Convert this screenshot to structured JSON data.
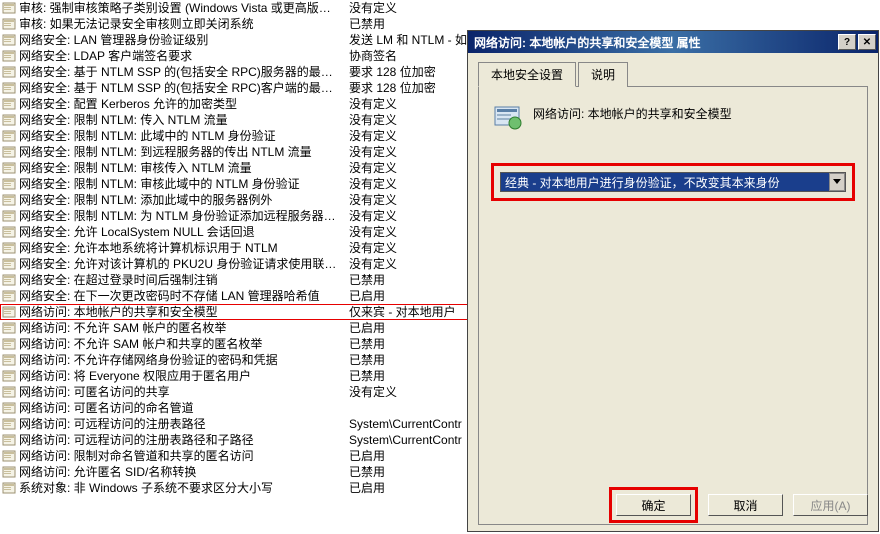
{
  "policies": [
    {
      "name": "审核: 强制审核策略子类别设置 (Windows Vista 或更高版…",
      "value": "没有定义"
    },
    {
      "name": "审核: 如果无法记录安全审核则立即关闭系统",
      "value": "已禁用"
    },
    {
      "name": "网络安全: LAN 管理器身份验证级别",
      "value": "发送 LM 和 NTLM - 如"
    },
    {
      "name": "网络安全: LDAP 客户端签名要求",
      "value": "协商签名"
    },
    {
      "name": "网络安全: 基于 NTLM SSP 的(包括安全 RPC)服务器的最…",
      "value": "要求 128 位加密"
    },
    {
      "name": "网络安全: 基于 NTLM SSP 的(包括安全 RPC)客户端的最…",
      "value": "要求 128 位加密"
    },
    {
      "name": "网络安全: 配置 Kerberos 允许的加密类型",
      "value": "没有定义"
    },
    {
      "name": "网络安全: 限制 NTLM: 传入 NTLM 流量",
      "value": "没有定义"
    },
    {
      "name": "网络安全: 限制 NTLM: 此域中的 NTLM 身份验证",
      "value": "没有定义"
    },
    {
      "name": "网络安全: 限制 NTLM: 到远程服务器的传出 NTLM 流量",
      "value": "没有定义"
    },
    {
      "name": "网络安全: 限制 NTLM: 审核传入 NTLM 流量",
      "value": "没有定义"
    },
    {
      "name": "网络安全: 限制 NTLM: 审核此域中的 NTLM 身份验证",
      "value": "没有定义"
    },
    {
      "name": "网络安全: 限制 NTLM: 添加此域中的服务器例外",
      "value": "没有定义"
    },
    {
      "name": "网络安全: 限制 NTLM: 为 NTLM 身份验证添加远程服务器…",
      "value": "没有定义"
    },
    {
      "name": "网络安全: 允许 LocalSystem NULL 会话回退",
      "value": "没有定义"
    },
    {
      "name": "网络安全: 允许本地系统将计算机标识用于 NTLM",
      "value": "没有定义"
    },
    {
      "name": "网络安全: 允许对该计算机的 PKU2U 身份验证请求使用联…",
      "value": "没有定义"
    },
    {
      "name": "网络安全: 在超过登录时间后强制注销",
      "value": "已禁用"
    },
    {
      "name": "网络安全: 在下一次更改密码时不存储 LAN 管理器哈希值",
      "value": "已启用"
    },
    {
      "name": "网络访问: 本地帐户的共享和安全模型",
      "value": "仅来宾 - 对本地用户"
    },
    {
      "name": "网络访问: 不允许 SAM 帐户的匿名枚举",
      "value": "已启用"
    },
    {
      "name": "网络访问: 不允许 SAM 帐户和共享的匿名枚举",
      "value": "已禁用"
    },
    {
      "name": "网络访问: 不允许存储网络身份验证的密码和凭据",
      "value": "已禁用"
    },
    {
      "name": "网络访问: 将 Everyone 权限应用于匿名用户",
      "value": "已禁用"
    },
    {
      "name": "网络访问: 可匿名访问的共享",
      "value": "没有定义"
    },
    {
      "name": "网络访问: 可匿名访问的命名管道",
      "value": ""
    },
    {
      "name": "网络访问: 可远程访问的注册表路径",
      "value": "System\\CurrentContr"
    },
    {
      "name": "网络访问: 可远程访问的注册表路径和子路径",
      "value": "System\\CurrentContr"
    },
    {
      "name": "网络访问: 限制对命名管道和共享的匿名访问",
      "value": "已启用"
    },
    {
      "name": "网络访问: 允许匿名 SID/名称转换",
      "value": "已禁用"
    },
    {
      "name": "系统对象: 非 Windows 子系统不要求区分大小写",
      "value": "已启用"
    }
  ],
  "highlightedIndex": 19,
  "dialog": {
    "title": "网络访问: 本地帐户的共享和安全模型 属性",
    "tabs": {
      "tab1": "本地安全设置",
      "tab2": "说明"
    },
    "infoText": "网络访问: 本地帐户的共享和安全模型",
    "dropdownValue": "经典 - 对本地用户进行身份验证，不改变其本来身份",
    "buttons": {
      "ok": "确定",
      "cancel": "取消",
      "apply": "应用(A)"
    }
  }
}
